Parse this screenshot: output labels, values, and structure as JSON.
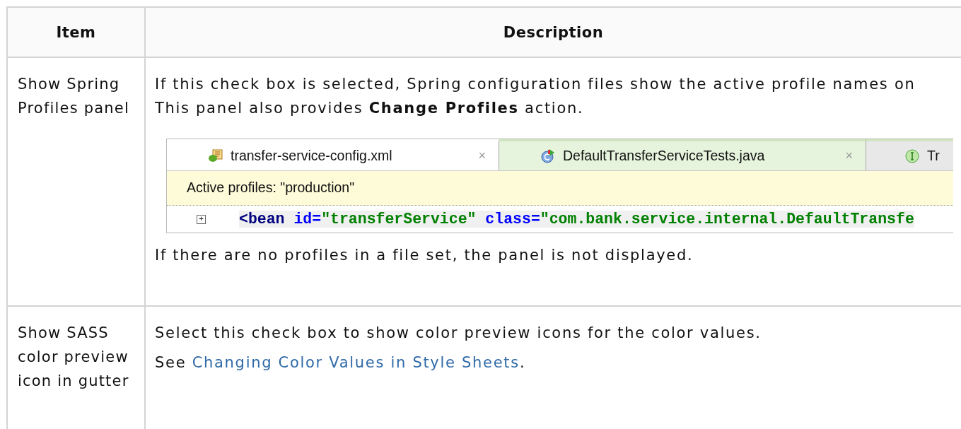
{
  "table": {
    "columns": [
      "Item",
      "Description"
    ],
    "rows": [
      {
        "item": "Show Spring Profiles panel",
        "blocks": [
          {
            "kind": "text",
            "text": "If this check box is selected, Spring configuration files show the active profile names on"
          },
          {
            "kind": "text",
            "text": "This panel also provides **Change Profiles** action."
          },
          {
            "kind": "screenshot",
            "tabs": [
              {
                "label": "transfer-service-config.xml",
                "kind": "xml",
                "selected": true,
                "close": "×"
              },
              {
                "label": "DefaultTransferServiceTests.java",
                "kind": "class",
                "selected": false,
                "close": "×"
              },
              {
                "label": "Tr",
                "kind": "interface",
                "selected": false
              }
            ],
            "banner": "Active profiles: \"production\"",
            "expander": "+",
            "code": [
              {
                "kind": "tag",
                "text": "<bean"
              },
              {
                "kind": "attr",
                "text": " id="
              },
              {
                "kind": "value",
                "text": "\"transferService\""
              },
              {
                "kind": "attr",
                "text": " class="
              },
              {
                "kind": "value",
                "text": "\"com.bank.service.internal.DefaultTransfe"
              }
            ]
          },
          {
            "kind": "text",
            "text": "If there are no profiles in a file set, the panel is not displayed."
          }
        ]
      },
      {
        "item": "Show SASS color preview icon in gutter",
        "blocks": [
          {
            "kind": "text",
            "text": "Select this check box to show color preview icons for the color values."
          },
          {
            "kind": "link",
            "before": "See ",
            "link": "Changing Color Values in Style Sheets",
            "after": "."
          }
        ]
      }
    ]
  }
}
